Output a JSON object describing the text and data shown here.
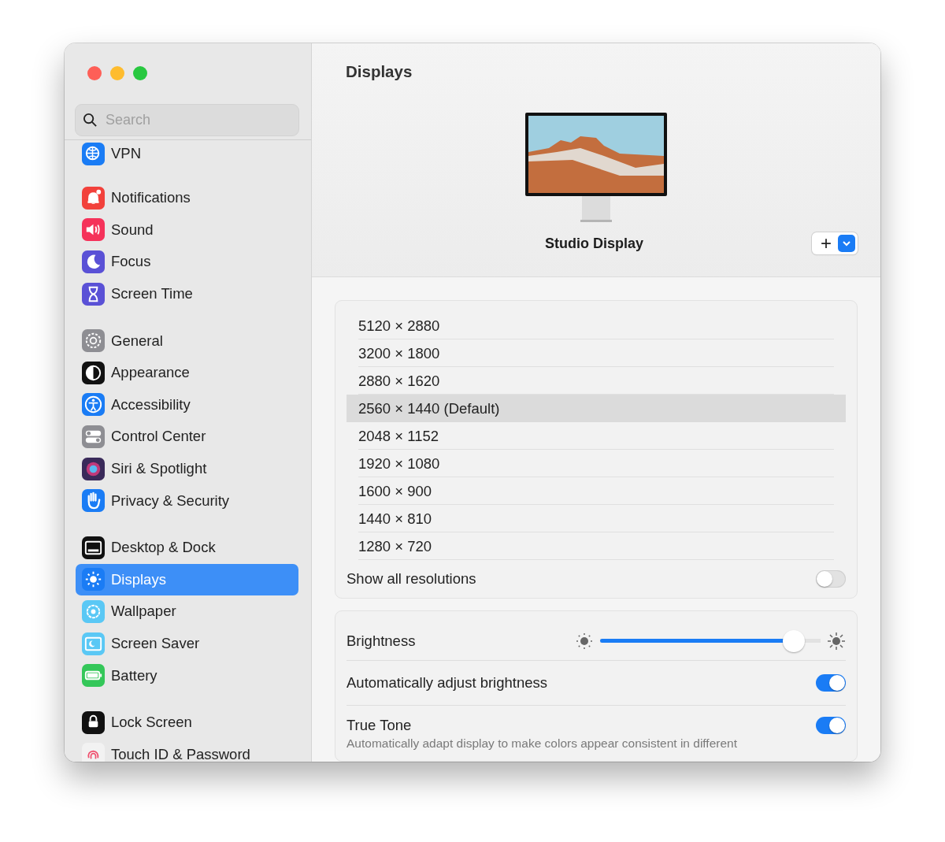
{
  "window": {
    "controls": [
      {
        "color": "#fe5f57"
      },
      {
        "color": "#febc2e"
      },
      {
        "color": "#28c840"
      }
    ]
  },
  "sidebar": {
    "search": {
      "placeholder": "Search"
    },
    "groups": [
      {
        "items": [
          {
            "label": "VPN",
            "color": "#1a7cf5",
            "selected": false
          }
        ]
      },
      {
        "items": [
          {
            "label": "Notifications",
            "color": "#f2413b",
            "selected": false
          },
          {
            "label": "Sound",
            "color": "#f5325a",
            "selected": false
          },
          {
            "label": "Focus",
            "color": "#5a51d6",
            "selected": false
          },
          {
            "label": "Screen Time",
            "color": "#5a51d6",
            "selected": false
          }
        ]
      },
      {
        "items": [
          {
            "label": "General",
            "color": "#8e8e93",
            "selected": false
          },
          {
            "label": "Appearance",
            "color": "#111111",
            "selected": false
          },
          {
            "label": "Accessibility",
            "color": "#1a7cf5",
            "selected": false
          },
          {
            "label": "Control Center",
            "color": "#8e8e93",
            "selected": false
          },
          {
            "label": "Siri & Spotlight",
            "color": "#3a2a5a",
            "selected": false
          },
          {
            "label": "Privacy & Security",
            "color": "#1a7cf5",
            "selected": false
          }
        ]
      },
      {
        "items": [
          {
            "label": "Desktop & Dock",
            "color": "#111111",
            "selected": false
          },
          {
            "label": "Displays",
            "color": "#1a7cf5",
            "selected": true
          },
          {
            "label": "Wallpaper",
            "color": "#5ac8f5",
            "selected": false
          },
          {
            "label": "Screen Saver",
            "color": "#5ac8f5",
            "selected": false
          },
          {
            "label": "Battery",
            "color": "#34c759",
            "selected": false
          }
        ]
      },
      {
        "items": [
          {
            "label": "Lock Screen",
            "color": "#111111",
            "selected": false
          },
          {
            "label": "Touch ID & Password",
            "color": "#f2f2f2",
            "selected": false
          }
        ]
      }
    ]
  },
  "main": {
    "title": "Displays",
    "display": {
      "name": "Studio Display",
      "add_button": "+"
    },
    "resolutions": [
      {
        "label": "5120 × 2880",
        "selected": false
      },
      {
        "label": "3200 × 1800",
        "selected": false
      },
      {
        "label": "2880 × 1620",
        "selected": false
      },
      {
        "label": "2560 × 1440 (Default)",
        "selected": true
      },
      {
        "label": "2048 × 1152",
        "selected": false
      },
      {
        "label": "1920 × 1080",
        "selected": false
      },
      {
        "label": "1600 × 900",
        "selected": false
      },
      {
        "label": "1440 × 810",
        "selected": false
      },
      {
        "label": "1280 × 720",
        "selected": false
      }
    ],
    "show_all": {
      "label": "Show all resolutions",
      "on": false
    },
    "brightness": {
      "label": "Brightness",
      "level": 0.88
    },
    "auto_brightness": {
      "label": "Automatically adjust brightness",
      "on": true
    },
    "true_tone": {
      "label": "True Tone",
      "on": true,
      "description": "Automatically adapt display to make colors appear consistent in different"
    }
  }
}
